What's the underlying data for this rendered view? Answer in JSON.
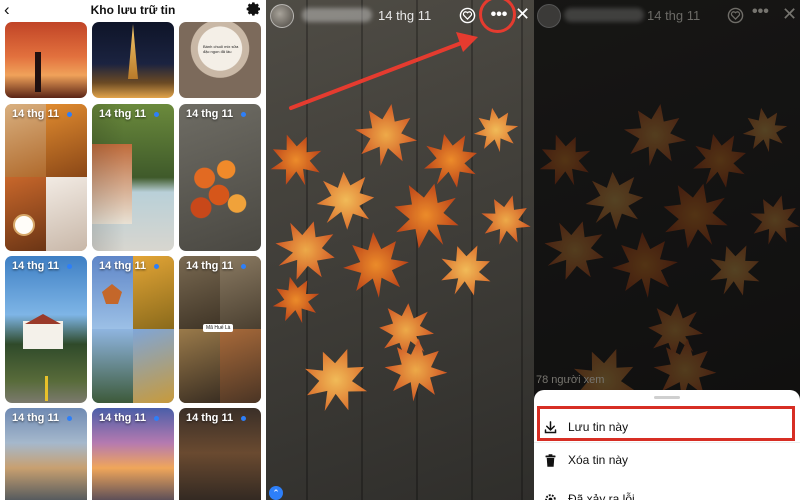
{
  "archive": {
    "title": "Kho lưu trữ tin",
    "back_icon": "back-arrow-icon",
    "settings_icon": "gear-icon",
    "tiles": [
      {
        "date": ""
      },
      {
        "date": ""
      },
      {
        "date": "",
        "caption": "Bánh chuối mix sữa đặc ngon đã lâu"
      },
      {
        "date": "14 thg 11"
      },
      {
        "date": "14 thg 11"
      },
      {
        "date": "14 thg 11"
      },
      {
        "date": "14 thg 11"
      },
      {
        "date": "14 thg 11"
      },
      {
        "date": "14 thg 11"
      },
      {
        "date": "14 thg 11"
      },
      {
        "date": "14 thg 11"
      },
      {
        "date": "14 thg 11"
      }
    ],
    "badge_label": "Mã Huế Là"
  },
  "story": {
    "time": "14 thg 11",
    "more_icon": "more-dots-icon",
    "close_icon": "close-icon",
    "heart_icon": "heart-check-icon",
    "highlight_color": "#e53b2f"
  },
  "sheet_view": {
    "time": "14 thg 11",
    "viewers": "78 người xem",
    "options": [
      {
        "label": "Lưu tin này",
        "icon": "download-icon"
      },
      {
        "label": "Xóa tin này",
        "icon": "trash-icon"
      },
      {
        "label": "Đã xảy ra lỗi",
        "icon": "gear-icon"
      }
    ],
    "highlight_color": "#d72e24"
  }
}
